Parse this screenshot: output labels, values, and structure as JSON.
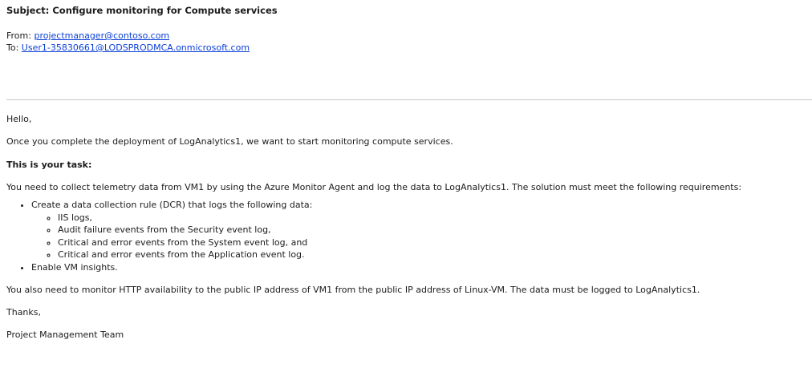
{
  "email": {
    "subject": "Subject: Configure monitoring for Compute services",
    "from_label": "From: ",
    "from_address": "projectmanager@contoso.com",
    "to_label": "To: ",
    "to_address": "User1-35830661@LODSPRODMCA.onmicrosoft.com"
  },
  "body": {
    "greeting": "Hello,",
    "intro": "Once you complete the deployment of LogAnalytics1, we want to start monitoring compute services.",
    "task_heading": "This is your task:",
    "task_description": "You need to collect telemetry data from VM1 by using the Azure Monitor Agent and log the data to LogAnalytics1. The solution must meet the following requirements:",
    "requirements": [
      {
        "text": "Create a data collection rule (DCR) that logs the following data:",
        "sub_items": [
          "IIS logs,",
          "Audit failure events from the Security event log,",
          "Critical and error events from the System event log, and",
          "Critical and error events from the Application event log."
        ]
      },
      {
        "text": "Enable VM insights."
      }
    ],
    "followup": "You also need to monitor HTTP availability to the public IP address of VM1 from the public IP address of Linux-VM. The data must be logged to LogAnalytics1.",
    "closing": "Thanks,",
    "signature": "Project Management Team"
  }
}
